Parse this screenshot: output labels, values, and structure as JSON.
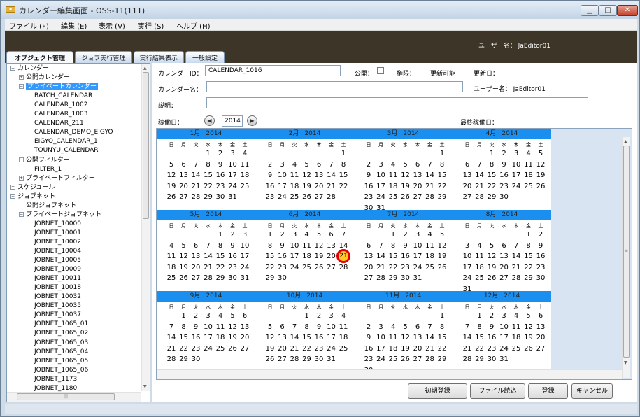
{
  "window": {
    "title": "カレンダー編集画面 - OSS-11(111)",
    "app_icon": "app-icon",
    "min": "▁",
    "max": "□",
    "close": "✕"
  },
  "menu": [
    {
      "label": "ファイル (F)"
    },
    {
      "label": "編集 (E)"
    },
    {
      "label": "表示 (V)"
    },
    {
      "label": "実行 (S)"
    },
    {
      "label": "ヘルプ (H)"
    }
  ],
  "header": {
    "user": "ユーザー名： JaEditor01"
  },
  "tabs": [
    {
      "label": "オブジェクト管理"
    },
    {
      "label": "ジョブ実行管理"
    },
    {
      "label": "実行結果表示"
    },
    {
      "label": "一般設定"
    }
  ],
  "tree": [
    {
      "label": "カレンダー",
      "exp": "−"
    },
    {
      "label": "公開カレンダー",
      "exp": "+"
    },
    {
      "label": "プライベートカレンダー",
      "exp": "−"
    },
    {
      "label": "BATCH_CALENDAR"
    },
    {
      "label": "CALENDAR_1002"
    },
    {
      "label": "CALENDAR_1003"
    },
    {
      "label": "CALENDAR_211"
    },
    {
      "label": "CALENDAR_DEMO_EIGYO"
    },
    {
      "label": "EIGYO_CALENDAR_1"
    },
    {
      "label": "TOUNYU_CALENDAR"
    },
    {
      "label": "公開フィルター",
      "exp": "−"
    },
    {
      "label": "FILTER_1"
    },
    {
      "label": "プライベートフィルター",
      "exp": "+"
    },
    {
      "label": "スケジュール",
      "exp": "+"
    },
    {
      "label": "ジョブネット",
      "exp": "−"
    },
    {
      "label": "公開ジョブネット"
    },
    {
      "label": "プライベートジョブネット",
      "exp": "−"
    },
    {
      "label": "JOBNET_10000"
    },
    {
      "label": "JOBNET_10001"
    },
    {
      "label": "JOBNET_10002"
    },
    {
      "label": "JOBNET_10004"
    },
    {
      "label": "JOBNET_10005"
    },
    {
      "label": "JOBNET_10009"
    },
    {
      "label": "JOBNET_10011"
    },
    {
      "label": "JOBNET_10018"
    },
    {
      "label": "JOBNET_10032"
    },
    {
      "label": "JOBNET_10035"
    },
    {
      "label": "JOBNET_10037"
    },
    {
      "label": "JOBNET_1065_01"
    },
    {
      "label": "JOBNET_1065_02"
    },
    {
      "label": "JOBNET_1065_03"
    },
    {
      "label": "JOBNET_1065_04"
    },
    {
      "label": "JOBNET_1065_05"
    },
    {
      "label": "JOBNET_1065_06"
    },
    {
      "label": "JOBNET_1173"
    },
    {
      "label": "JOBNET_1180"
    }
  ],
  "form": {
    "calendar_id_label": "カレンダーID：",
    "calendar_id": "CALENDAR_1016",
    "public_label": "公開：",
    "authority_label": "権限：",
    "authority": "更新可能",
    "updated_label": "更新日：",
    "name_label": "カレンダー名：",
    "user": "ユーザー名： JaEditor01",
    "desc_label": "説明：",
    "workday_label": "稼働日：",
    "year": "2014",
    "last_workday_label": "最終稼働日：",
    "prev": "◀",
    "next": "▶"
  },
  "calendar": {
    "weekdays": [
      "日",
      "月",
      "火",
      "水",
      "木",
      "金",
      "土"
    ],
    "year_label": "2014",
    "months": [
      "1月",
      "2月",
      "3月",
      "4月",
      "5月",
      "6月",
      "7月",
      "8月",
      "9月",
      "10月",
      "11月",
      "12月"
    ],
    "marked_day": "21"
  },
  "buttons": {
    "initial": "初期登録",
    "file_load": "ファイル読込",
    "register": "登録",
    "cancel": "キャンセル"
  }
}
